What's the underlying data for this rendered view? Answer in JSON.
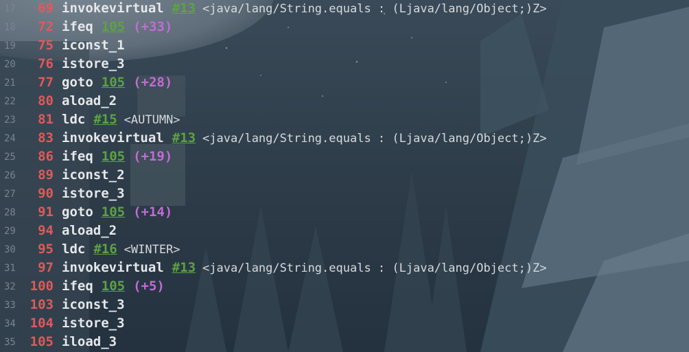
{
  "lines": [
    {
      "ln": "17",
      "off": "69",
      "op": "invokevirtual",
      "ref": "#13",
      "rel": "",
      "comment": "<java/lang/String.equals : (Ljava/lang/Object;)Z>"
    },
    {
      "ln": "18",
      "off": "72",
      "op": "ifeq",
      "ref": "105",
      "rel": "(+33)",
      "comment": ""
    },
    {
      "ln": "19",
      "off": "75",
      "op": "iconst_1",
      "ref": "",
      "rel": "",
      "comment": ""
    },
    {
      "ln": "20",
      "off": "76",
      "op": "istore_3",
      "ref": "",
      "rel": "",
      "comment": ""
    },
    {
      "ln": "21",
      "off": "77",
      "op": "goto",
      "ref": "105",
      "rel": "(+28)",
      "comment": ""
    },
    {
      "ln": "22",
      "off": "80",
      "op": "aload_2",
      "ref": "",
      "rel": "",
      "comment": ""
    },
    {
      "ln": "23",
      "off": "81",
      "op": "ldc",
      "ref": "#15",
      "rel": "",
      "comment": "<AUTUMN>"
    },
    {
      "ln": "24",
      "off": "83",
      "op": "invokevirtual",
      "ref": "#13",
      "rel": "",
      "comment": "<java/lang/String.equals : (Ljava/lang/Object;)Z>"
    },
    {
      "ln": "25",
      "off": "86",
      "op": "ifeq",
      "ref": "105",
      "rel": "(+19)",
      "comment": ""
    },
    {
      "ln": "26",
      "off": "89",
      "op": "iconst_2",
      "ref": "",
      "rel": "",
      "comment": ""
    },
    {
      "ln": "27",
      "off": "90",
      "op": "istore_3",
      "ref": "",
      "rel": "",
      "comment": ""
    },
    {
      "ln": "28",
      "off": "91",
      "op": "goto",
      "ref": "105",
      "rel": "(+14)",
      "comment": ""
    },
    {
      "ln": "29",
      "off": "94",
      "op": "aload_2",
      "ref": "",
      "rel": "",
      "comment": ""
    },
    {
      "ln": "30",
      "off": "95",
      "op": "ldc",
      "ref": "#16",
      "rel": "",
      "comment": "<WINTER>"
    },
    {
      "ln": "31",
      "off": "97",
      "op": "invokevirtual",
      "ref": "#13",
      "rel": "",
      "comment": "<java/lang/String.equals : (Ljava/lang/Object;)Z>"
    },
    {
      "ln": "32",
      "off": "100",
      "op": "ifeq",
      "ref": "105",
      "rel": "(+5)",
      "comment": ""
    },
    {
      "ln": "33",
      "off": "103",
      "op": "iconst_3",
      "ref": "",
      "rel": "",
      "comment": ""
    },
    {
      "ln": "34",
      "off": "104",
      "op": "istore_3",
      "ref": "",
      "rel": "",
      "comment": ""
    },
    {
      "ln": "35",
      "off": "105",
      "op": "iload_3",
      "ref": "",
      "rel": "",
      "comment": ""
    }
  ],
  "colors": {
    "offset": "#e05a5a",
    "opcode": "#e6e8ea",
    "reference": "#5ca342",
    "relative_jump": "#c36bd6",
    "comment": "#d7dadd",
    "gutter": "#7a8590",
    "background": "#2b3845"
  }
}
